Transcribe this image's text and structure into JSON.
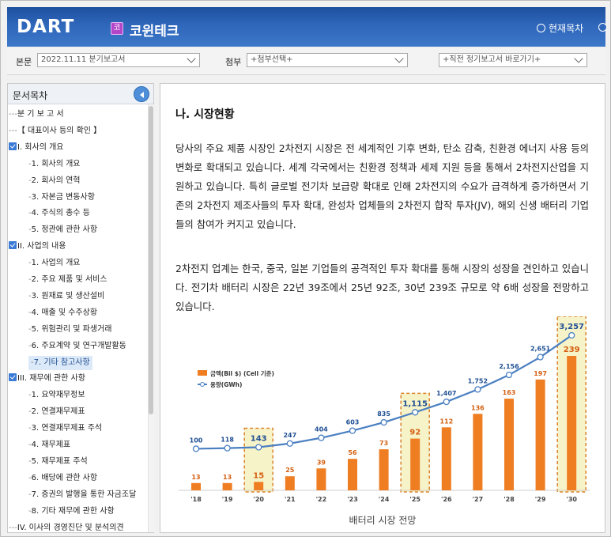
{
  "header": {
    "logo": "DART",
    "company_badge": "코",
    "company_name": "코윈테크",
    "current_doc_label": "현재목차"
  },
  "toolbar": {
    "report_label": "본문",
    "report_value": "2022.11.11  분기보고서",
    "attach_label": "첨부",
    "attach_value": "+첨부선택+",
    "quick_value": "+직전 정기보고서 바로가기+"
  },
  "sidebar": {
    "title": "문서목차",
    "items": [
      {
        "label": "분 기 보 고 서",
        "prefix": "-",
        "level": 0,
        "checked": false
      },
      {
        "label": "【 대표이사 등의 확인 】",
        "prefix": "-",
        "level": 0,
        "checked": false
      },
      {
        "label": "I. 회사의 개요",
        "prefix": "",
        "level": 0,
        "checked": true
      },
      {
        "label": "1. 회사의 개요",
        "prefix": "-",
        "level": 1,
        "checked": false
      },
      {
        "label": "2. 회사의 연혁",
        "prefix": "-",
        "level": 1,
        "checked": false
      },
      {
        "label": "3. 자본금 변동사항",
        "prefix": "-",
        "level": 1,
        "checked": false
      },
      {
        "label": "4. 주식의 총수 등",
        "prefix": "-",
        "level": 1,
        "checked": false
      },
      {
        "label": "5. 정관에 관한 사항",
        "prefix": "-",
        "level": 1,
        "checked": false
      },
      {
        "label": "II. 사업의 내용",
        "prefix": "",
        "level": 0,
        "checked": true
      },
      {
        "label": "1. 사업의 개요",
        "prefix": "-",
        "level": 1,
        "checked": false
      },
      {
        "label": "2. 주요 제품 및 서비스",
        "prefix": "-",
        "level": 1,
        "checked": false
      },
      {
        "label": "3. 원재료 및 생산설비",
        "prefix": "-",
        "level": 1,
        "checked": false
      },
      {
        "label": "4. 매출 및 수주상황",
        "prefix": "-",
        "level": 1,
        "checked": false
      },
      {
        "label": "5. 위험관리 및 파생거래",
        "prefix": "-",
        "level": 1,
        "checked": false
      },
      {
        "label": "6. 주요계약 및 연구개발활동",
        "prefix": "-",
        "level": 1,
        "checked": false
      },
      {
        "label": "7. 기타 참고사항",
        "prefix": "-",
        "level": 1,
        "checked": false,
        "active": true
      },
      {
        "label": "III. 재무에 관한 사항",
        "prefix": "",
        "level": 0,
        "checked": true
      },
      {
        "label": "1. 요약재무정보",
        "prefix": "-",
        "level": 1,
        "checked": false
      },
      {
        "label": "2. 연결재무제표",
        "prefix": "-",
        "level": 1,
        "checked": false
      },
      {
        "label": "3. 연결재무제표 주석",
        "prefix": "-",
        "level": 1,
        "checked": false
      },
      {
        "label": "4. 재무제표",
        "prefix": "-",
        "level": 1,
        "checked": false
      },
      {
        "label": "5. 재무제표 주석",
        "prefix": "-",
        "level": 1,
        "checked": false
      },
      {
        "label": "6. 배당에 관한 사항",
        "prefix": "-",
        "level": 1,
        "checked": false
      },
      {
        "label": "7. 증권의 발행을 통한 자금조달",
        "prefix": "-",
        "level": 1,
        "checked": false
      },
      {
        "label": "8. 기타 재무에 관한 사항",
        "prefix": "-",
        "level": 1,
        "checked": false
      },
      {
        "label": "IV. 이사의 경영진단 및 분석의견",
        "prefix": "-",
        "level": 0,
        "checked": false
      }
    ]
  },
  "content": {
    "section_title": "나. 시장현황",
    "paragraph1": "당사의 주요 제품 시장인 2차전지 시장은 전 세계적인 기후 변화, 탄소 감축, 친환경 에너지 사용 등의 변화로 확대되고 있습니다. 세계 각국에서는 친환경 정책과 세제 지원 등을 통해서 2차전지산업을 지원하고 있습니다. 특히 글로벌 전기차 보급량 확대로 인해 2차전지의 수요가 급격하게 증가하면서 기존의 2차전지 제조사들의 투자 확대, 완성차 업체들의 2차전지 합작 투자(JV), 해외 신생 배터리 기업들의 참여가 커지고 있습니다.",
    "paragraph2": "2차전지 업계는 한국, 중국, 일본 기업들의 공격적인 투자 확대를 통해 시장의 성장을 견인하고 있습니다. 전기차 배터리 시장은 22년 39조에서 25년 92조, 30년 239조 규모로 약 6배 성장을 전망하고 있습니다."
  },
  "chart_data": {
    "type": "bar",
    "caption": "배터리 시장 전망",
    "categories": [
      "'18",
      "'19",
      "'20",
      "'21",
      "'22",
      "'23",
      "'24",
      "'25",
      "'26",
      "'27",
      "'28",
      "'29",
      "'30"
    ],
    "series": [
      {
        "name": "금액(Bil $) (Cell 기준)",
        "type": "bar",
        "values": [
          13,
          13,
          15,
          25,
          39,
          56,
          73,
          92,
          112,
          136,
          163,
          197,
          239
        ]
      },
      {
        "name": "용량(GWh)",
        "type": "line",
        "values": [
          100,
          118,
          143,
          247,
          404,
          603,
          835,
          1115,
          1407,
          1752,
          2156,
          2651,
          3257
        ]
      }
    ],
    "highlighted_categories": [
      "'20",
      "'25",
      "'30"
    ],
    "colors": {
      "bar": "#ef7d22",
      "line": "#4a7fc1",
      "highlight_box": "#f7f3c9",
      "highlight_border": "#d9832a"
    }
  }
}
